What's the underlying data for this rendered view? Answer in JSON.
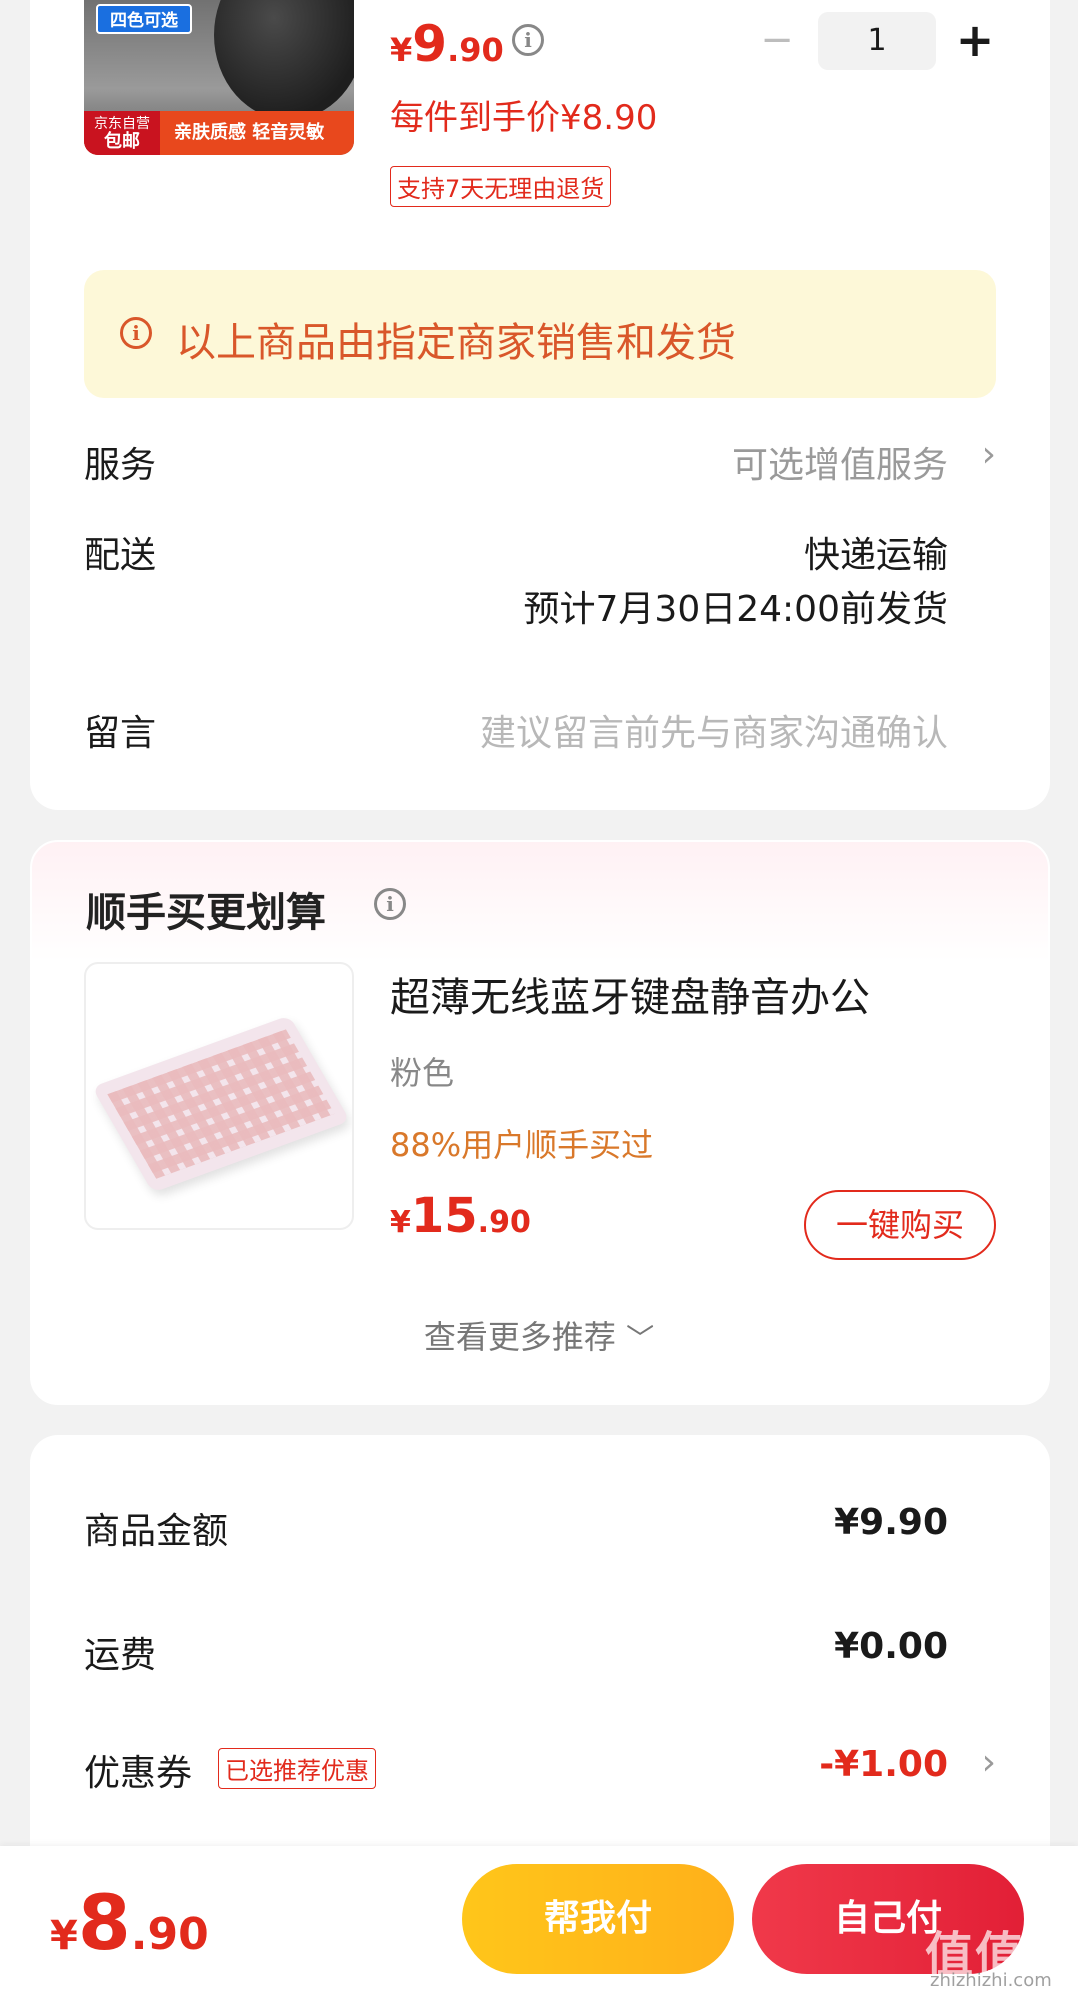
{
  "product": {
    "image_tags": {
      "top_badge": "四色可选",
      "left_badge_line1": "京东自营",
      "left_badge_line2": "包邮",
      "bottom_text": "亲肤质感 轻音灵敏"
    },
    "price": {
      "currency": "¥",
      "integer": "9",
      "decimal": ".90"
    },
    "quantity": "1",
    "each_price": "每件到手价¥8.90",
    "return_policy": "支持7天无理由退货"
  },
  "notice": "以上商品由指定商家销售和发货",
  "service": {
    "label": "服务",
    "value": "可选增值服务"
  },
  "delivery": {
    "label": "配送",
    "method": "快递运输",
    "eta": "预计7月30日24:00前发货"
  },
  "message": {
    "label": "留言",
    "placeholder": "建议留言前先与商家沟通确认"
  },
  "recommend": {
    "title": "顺手买更划算",
    "item": {
      "name": "超薄无线蓝牙键盘静音办公",
      "color": "粉色",
      "stat": "88%用户顺手买过",
      "price": {
        "currency": "¥",
        "integer": "15",
        "decimal": ".90"
      },
      "buy_label": "一键购买"
    },
    "more_label": "查看更多推荐"
  },
  "summary": {
    "goods_label": "商品金额",
    "goods_value": "¥9.90",
    "shipping_label": "运费",
    "shipping_value": "¥0.00",
    "coupon_label": "优惠券",
    "coupon_tag": "已选推荐优惠",
    "coupon_value": "-¥1.00"
  },
  "footer": {
    "total": {
      "currency": "¥",
      "integer": "8",
      "decimal": ".90"
    },
    "help_pay_label": "帮我付",
    "self_pay_label": "自己付"
  },
  "watermark": {
    "main": "值值值",
    "sub": "zhizhizhi.com"
  },
  "colors": {
    "accent": "#e22a1c",
    "notice_bg": "#fdf8d8",
    "help_btn": "#ffb81a",
    "self_btn": "#e8283d"
  }
}
